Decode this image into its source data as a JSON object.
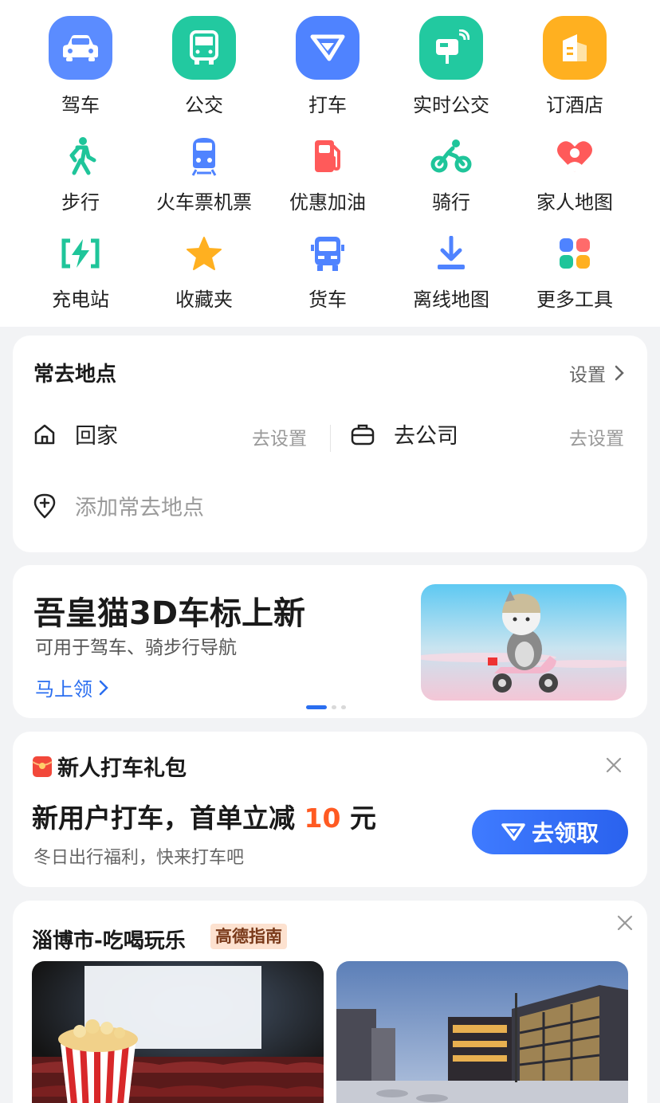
{
  "tools": {
    "row1": [
      {
        "label": "驾车",
        "icon": "car-icon",
        "color": "#5b8cff"
      },
      {
        "label": "公交",
        "icon": "bus-icon",
        "color": "#22c9a0"
      },
      {
        "label": "打车",
        "icon": "taxi-logo-icon",
        "color": "#4f83ff"
      },
      {
        "label": "实时公交",
        "icon": "realtime-bus-icon",
        "color": "#22c9a0"
      },
      {
        "label": "订酒店",
        "icon": "hotel-icon",
        "color": "#ffb020"
      }
    ],
    "row2": [
      {
        "label": "步行",
        "icon": "walk-icon",
        "color": "#1fc59a"
      },
      {
        "label": "火车票机票",
        "icon": "train-icon",
        "color": "#4f83ff"
      },
      {
        "label": "优惠加油",
        "icon": "fuel-icon",
        "color": "#ff5a5a"
      },
      {
        "label": "骑行",
        "icon": "bike-icon",
        "color": "#1fc59a"
      },
      {
        "label": "家人地图",
        "icon": "family-heart-icon",
        "color": "#ff5a5a"
      }
    ],
    "row3": [
      {
        "label": "充电站",
        "icon": "charging-icon",
        "color": "#1fc59a"
      },
      {
        "label": "收藏夹",
        "icon": "star-icon",
        "color": "#ffb020"
      },
      {
        "label": "货车",
        "icon": "truck-icon",
        "color": "#4f83ff"
      },
      {
        "label": "离线地图",
        "icon": "download-icon",
        "color": "#4f83ff"
      },
      {
        "label": "更多工具",
        "icon": "more-tools-icon",
        "color": "#4f83ff"
      }
    ]
  },
  "frequent": {
    "title": "常去地点",
    "settings_label": "设置",
    "home_label": "回家",
    "home_set": "去设置",
    "work_label": "去公司",
    "work_set": "去设置",
    "add_placeholder": "添加常去地点"
  },
  "banner": {
    "title": "吾皇猫3D车标上新",
    "subtitle": "可用于驾车、骑步行导航",
    "link": "马上领"
  },
  "taxi_promo": {
    "header": "新人打车礼包",
    "main_prefix": "新用户打车，首单立减",
    "amount": "10",
    "unit": "元",
    "sub": "冬日出行福利，快来打车吧",
    "button": "去领取"
  },
  "food": {
    "title": "淄博市-吃喝玩乐",
    "badge": "高德指南"
  },
  "colors": {
    "accent": "#2a6ef0",
    "highlight": "#ff5a22"
  }
}
